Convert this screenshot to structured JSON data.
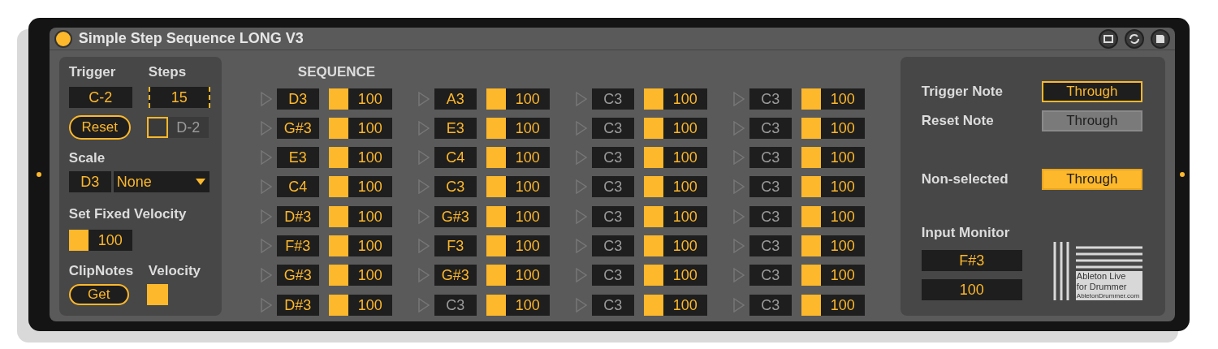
{
  "device": {
    "title": "Simple Step Sequence LONG V3",
    "on": true
  },
  "left": {
    "trigger": {
      "label": "Trigger",
      "value": "C-2"
    },
    "steps": {
      "label": "Steps",
      "value": "15"
    },
    "reset": {
      "label": "Reset"
    },
    "reset_note": {
      "checked": false,
      "value": "D-2"
    },
    "scale": {
      "label": "Scale",
      "root": "D3",
      "mode": "None"
    },
    "fixed_velocity": {
      "label": "Set Fixed Velocity",
      "on": true,
      "value": "100"
    },
    "clipnotes": {
      "label": "ClipNotes",
      "button": "Get"
    },
    "velocity": {
      "label": "Velocity",
      "checked": true
    }
  },
  "sequence": {
    "title": "SEQUENCE",
    "columns": [
      [
        {
          "note": "D3",
          "active": true,
          "on": true,
          "velocity": "100"
        },
        {
          "note": "G#3",
          "active": true,
          "on": true,
          "velocity": "100"
        },
        {
          "note": "E3",
          "active": true,
          "on": true,
          "velocity": "100"
        },
        {
          "note": "C4",
          "active": true,
          "on": true,
          "velocity": "100"
        },
        {
          "note": "D#3",
          "active": true,
          "on": true,
          "velocity": "100"
        },
        {
          "note": "F#3",
          "active": true,
          "on": true,
          "velocity": "100"
        },
        {
          "note": "G#3",
          "active": true,
          "on": true,
          "velocity": "100"
        },
        {
          "note": "D#3",
          "active": true,
          "on": true,
          "velocity": "100"
        }
      ],
      [
        {
          "note": "A3",
          "active": true,
          "on": true,
          "velocity": "100"
        },
        {
          "note": "E3",
          "active": true,
          "on": true,
          "velocity": "100"
        },
        {
          "note": "C4",
          "active": true,
          "on": true,
          "velocity": "100"
        },
        {
          "note": "C3",
          "active": true,
          "on": true,
          "velocity": "100"
        },
        {
          "note": "G#3",
          "active": true,
          "on": true,
          "velocity": "100"
        },
        {
          "note": "F3",
          "active": true,
          "on": true,
          "velocity": "100"
        },
        {
          "note": "G#3",
          "active": true,
          "on": true,
          "velocity": "100"
        },
        {
          "note": "C3",
          "active": false,
          "on": true,
          "velocity": "100"
        }
      ],
      [
        {
          "note": "C3",
          "active": false,
          "on": true,
          "velocity": "100"
        },
        {
          "note": "C3",
          "active": false,
          "on": true,
          "velocity": "100"
        },
        {
          "note": "C3",
          "active": false,
          "on": true,
          "velocity": "100"
        },
        {
          "note": "C3",
          "active": false,
          "on": true,
          "velocity": "100"
        },
        {
          "note": "C3",
          "active": false,
          "on": true,
          "velocity": "100"
        },
        {
          "note": "C3",
          "active": false,
          "on": true,
          "velocity": "100"
        },
        {
          "note": "C3",
          "active": false,
          "on": true,
          "velocity": "100"
        },
        {
          "note": "C3",
          "active": false,
          "on": true,
          "velocity": "100"
        }
      ],
      [
        {
          "note": "C3",
          "active": false,
          "on": true,
          "velocity": "100"
        },
        {
          "note": "C3",
          "active": false,
          "on": true,
          "velocity": "100"
        },
        {
          "note": "C3",
          "active": false,
          "on": true,
          "velocity": "100"
        },
        {
          "note": "C3",
          "active": false,
          "on": true,
          "velocity": "100"
        },
        {
          "note": "C3",
          "active": false,
          "on": true,
          "velocity": "100"
        },
        {
          "note": "C3",
          "active": false,
          "on": true,
          "velocity": "100"
        },
        {
          "note": "C3",
          "active": false,
          "on": true,
          "velocity": "100"
        },
        {
          "note": "C3",
          "active": false,
          "on": true,
          "velocity": "100"
        }
      ]
    ]
  },
  "right": {
    "modes": [
      {
        "label": "Trigger Note",
        "value": "Through",
        "kind": "outlined"
      },
      {
        "label": "Reset Note",
        "value": "Through",
        "kind": "grey"
      },
      {
        "label": "Non-selected",
        "value": "Through",
        "kind": "filled"
      }
    ],
    "input_monitor": {
      "label": "Input Monitor",
      "note": "F#3",
      "velocity": "100"
    },
    "logo": {
      "lines": [
        "Ableton Live",
        "for Drummer"
      ],
      "url": "AbletonDrummer.com"
    }
  }
}
